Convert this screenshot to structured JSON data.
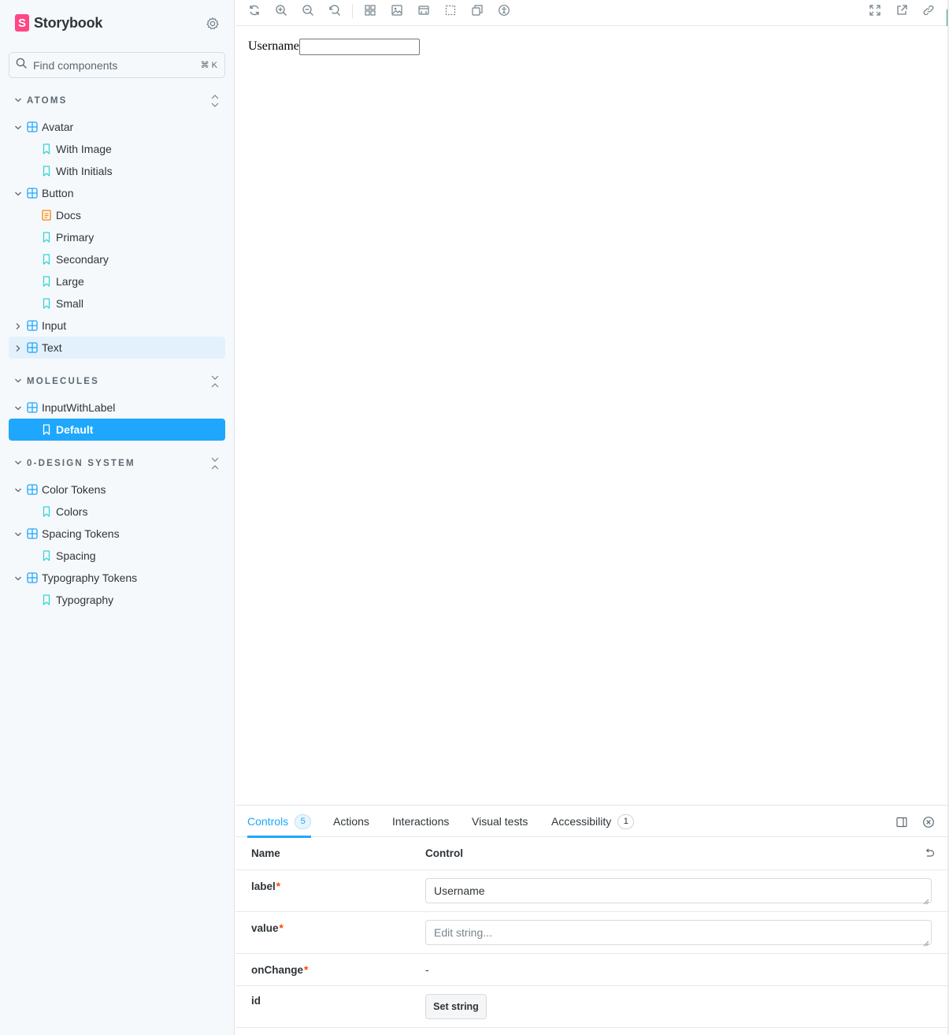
{
  "app": {
    "name": "Storybook",
    "logo_letter": "S"
  },
  "search": {
    "placeholder": "Find components",
    "shortcut": "⌘ K"
  },
  "sections": {
    "atoms": "ATOMS",
    "molecules": "MOLECULES",
    "design_system": "0-DESIGN SYSTEM"
  },
  "tree": {
    "avatar": "Avatar",
    "with_image": "With Image",
    "with_initials": "With Initials",
    "button": "Button",
    "docs": "Docs",
    "primary": "Primary",
    "secondary": "Secondary",
    "large": "Large",
    "small": "Small",
    "input": "Input",
    "text": "Text",
    "input_with_label": "InputWithLabel",
    "default": "Default",
    "color_tokens": "Color Tokens",
    "colors": "Colors",
    "spacing_tokens": "Spacing Tokens",
    "spacing": "Spacing",
    "typography_tokens": "Typography Tokens",
    "typography": "Typography"
  },
  "preview": {
    "label": "Username"
  },
  "panel": {
    "tabs": {
      "controls": "Controls",
      "controls_count": "5",
      "actions": "Actions",
      "interactions": "Interactions",
      "visual_tests": "Visual tests",
      "accessibility": "Accessibility",
      "accessibility_count": "1"
    },
    "headers": {
      "name": "Name",
      "control": "Control"
    },
    "rows": {
      "label": {
        "name": "label",
        "required": "*",
        "value": "Username"
      },
      "value": {
        "name": "value",
        "required": "*",
        "placeholder": "Edit string..."
      },
      "onChange": {
        "name": "onChange",
        "required": "*",
        "value": "-"
      },
      "id": {
        "name": "id",
        "button": "Set string"
      }
    }
  },
  "colors": {
    "brand_pink": "#ff4785",
    "accent_blue": "#1ea7fd",
    "component_icon": "#1ea7fd",
    "story_icon": "#37d5d3",
    "docs_icon": "#ff8300",
    "required_red": "#ff4400"
  }
}
